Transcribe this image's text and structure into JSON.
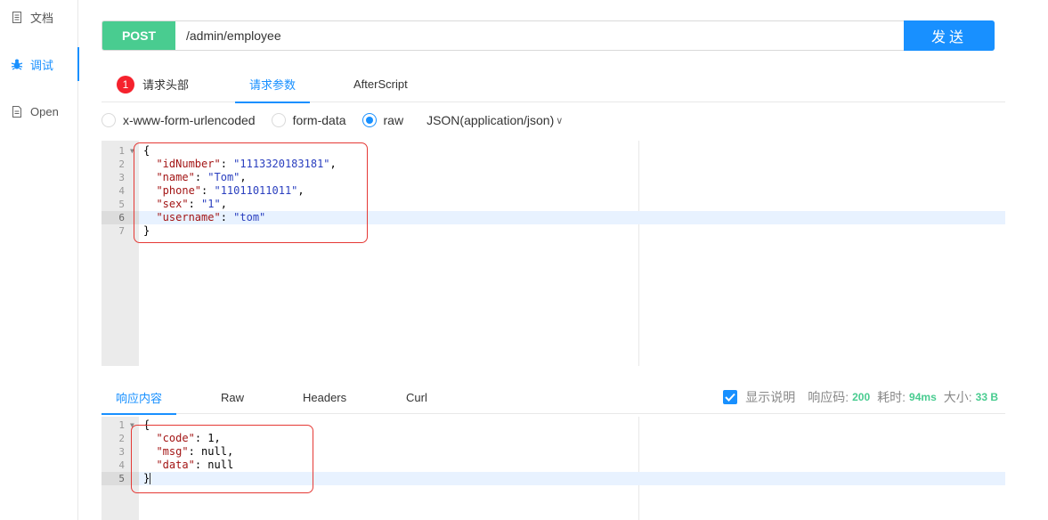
{
  "sidebar": {
    "items": [
      {
        "label": "文档",
        "icon": "document-icon"
      },
      {
        "label": "调试",
        "icon": "bug-icon"
      },
      {
        "label": "Open",
        "icon": "file-icon"
      }
    ]
  },
  "request": {
    "method": "POST",
    "url": "/admin/employee",
    "send_label": "发送"
  },
  "req_tabs": {
    "headers_badge": "1",
    "headers_label": "请求头部",
    "params_label": "请求参数",
    "afterscript_label": "AfterScript"
  },
  "body_types": {
    "urlencoded": "x-www-form-urlencoded",
    "formdata": "form-data",
    "raw": "raw",
    "content_type": "JSON(application/json)",
    "selected": "raw"
  },
  "request_body": {
    "line_numbers": [
      "1",
      "2",
      "3",
      "4",
      "5",
      "6",
      "7"
    ],
    "open_brace": "{",
    "close_brace": "}",
    "fields": [
      {
        "key": "\"idNumber\"",
        "value": "\"1113320183181\"",
        "sep": ","
      },
      {
        "key": "\"name\"",
        "value": "\"Tom\"",
        "sep": ","
      },
      {
        "key": "\"phone\"",
        "value": "\"11011011011\"",
        "sep": ","
      },
      {
        "key": "\"sex\"",
        "value": "\"1\"",
        "sep": ","
      },
      {
        "key": "\"username\"",
        "value": "\"tom\"",
        "sep": ""
      }
    ]
  },
  "res_tabs": {
    "content_label": "响应内容",
    "raw_label": "Raw",
    "headers_label": "Headers",
    "curl_label": "Curl"
  },
  "status": {
    "show_desc_label": "显示说明",
    "code_label": "响应码:",
    "code_value": "200",
    "time_label": "耗时:",
    "time_value": "94ms",
    "size_label": "大小:",
    "size_value": "33 B"
  },
  "response_body": {
    "line_numbers": [
      "1",
      "2",
      "3",
      "4",
      "5"
    ],
    "open_brace": "{",
    "close_brace": "}",
    "fields": [
      {
        "key": "\"code\"",
        "value": "1",
        "sep": ","
      },
      {
        "key": "\"msg\"",
        "value": "null",
        "sep": ","
      },
      {
        "key": "\"data\"",
        "value": "null",
        "sep": ""
      }
    ]
  },
  "colors": {
    "accent": "#1890ff",
    "method_post": "#49cc90",
    "badge": "#f5222d",
    "annotation": "#e53935"
  }
}
